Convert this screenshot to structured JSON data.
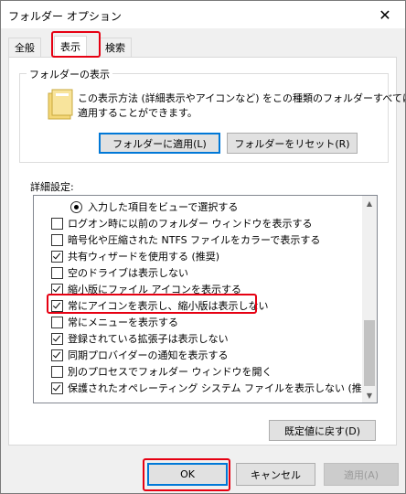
{
  "window": {
    "title": "フォルダー オプション",
    "close_glyph": "✕"
  },
  "tabs": [
    {
      "label": "全般"
    },
    {
      "label": "表示"
    },
    {
      "label": "検索"
    }
  ],
  "folder_views": {
    "legend": "フォルダーの表示",
    "description_line1": "この表示方法 (詳細表示やアイコンなど) をこの種類のフォルダーすべてに",
    "description_line2": "適用することができます。",
    "apply_button": "フォルダーに適用(L)",
    "reset_button": "フォルダーをリセット(R)"
  },
  "advanced": {
    "label": "詳細設定:",
    "items": [
      {
        "type": "radio",
        "checked": true,
        "label": "入力した項目をビューで選択する"
      },
      {
        "type": "checkbox",
        "checked": false,
        "label": "ログオン時に以前のフォルダー ウィンドウを表示する"
      },
      {
        "type": "checkbox",
        "checked": false,
        "label": "暗号化や圧縮された NTFS ファイルをカラーで表示する"
      },
      {
        "type": "checkbox",
        "checked": true,
        "label": "共有ウィザードを使用する (推奨)"
      },
      {
        "type": "checkbox",
        "checked": false,
        "label": "空のドライブは表示しない"
      },
      {
        "type": "checkbox",
        "checked": true,
        "label": "縮小版にファイル アイコンを表示する"
      },
      {
        "type": "checkbox",
        "checked": true,
        "label": "常にアイコンを表示し、縮小版は表示しない"
      },
      {
        "type": "checkbox",
        "checked": false,
        "label": "常にメニューを表示する"
      },
      {
        "type": "checkbox",
        "checked": true,
        "label": "登録されている拡張子は表示しない"
      },
      {
        "type": "checkbox",
        "checked": true,
        "label": "同期プロバイダーの通知を表示する"
      },
      {
        "type": "checkbox",
        "checked": false,
        "label": "別のプロセスでフォルダー ウィンドウを開く"
      },
      {
        "type": "checkbox",
        "checked": true,
        "label": "保護されたオペレーティング システム ファイルを表示しない (推奨)"
      }
    ],
    "restore_defaults_button": "既定値に戻す(D)"
  },
  "footer": {
    "ok_button": "OK",
    "cancel_button": "キャンセル",
    "apply_button": "適用(A)"
  },
  "colors": {
    "highlight": "#e60012",
    "focus": "#0078d7",
    "folder": "#f4d777"
  }
}
